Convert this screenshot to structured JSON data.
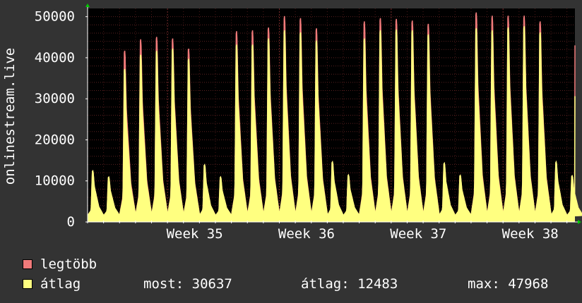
{
  "chart_data": {
    "type": "area",
    "ylabel": "onlinestream.live",
    "ylim": [
      0,
      52000
    ],
    "yticks": [
      0,
      10000,
      20000,
      30000,
      40000,
      50000
    ],
    "x_tick_labels": [
      "Week 35",
      "Week 36",
      "Week 37",
      "Week 38"
    ],
    "x_tick_positions_days": [
      5,
      12,
      19,
      26
    ],
    "x_range_days": [
      0,
      30.5
    ],
    "series": [
      {
        "name": "legtöbb",
        "color": "#f07a7a",
        "daily_peaks": [
          12500,
          11000,
          42000,
          44800,
          45400,
          45000,
          42500,
          14000,
          11000,
          46800,
          47000,
          47700,
          50500,
          50000,
          47500,
          14700,
          11500,
          49200,
          50000,
          49800,
          49400,
          48600,
          14400,
          11400,
          51400,
          50600,
          50600,
          50600,
          49200,
          14700,
          11300
        ],
        "final_value": 43000
      },
      {
        "name": "átlag",
        "color": "#ffff80",
        "daily_peaks": [
          12500,
          11000,
          37500,
          41000,
          42000,
          42500,
          40000,
          14000,
          11000,
          43500,
          43500,
          45000,
          47000,
          46500,
          44500,
          14700,
          11500,
          45000,
          47000,
          47200,
          47000,
          46000,
          14400,
          11400,
          47500,
          47000,
          47700,
          48000,
          46500,
          14700,
          11300
        ],
        "final_value": 30637
      }
    ],
    "grid": true,
    "legend_position": "bottom-left"
  },
  "legend": [
    {
      "label": "legtöbb",
      "color": "#f07a7a"
    },
    {
      "label": "átlag",
      "color": "#ffff80"
    }
  ],
  "stats": {
    "most": "most: 30637",
    "atlag": "átlag: 12483",
    "max": "max: 47968"
  }
}
